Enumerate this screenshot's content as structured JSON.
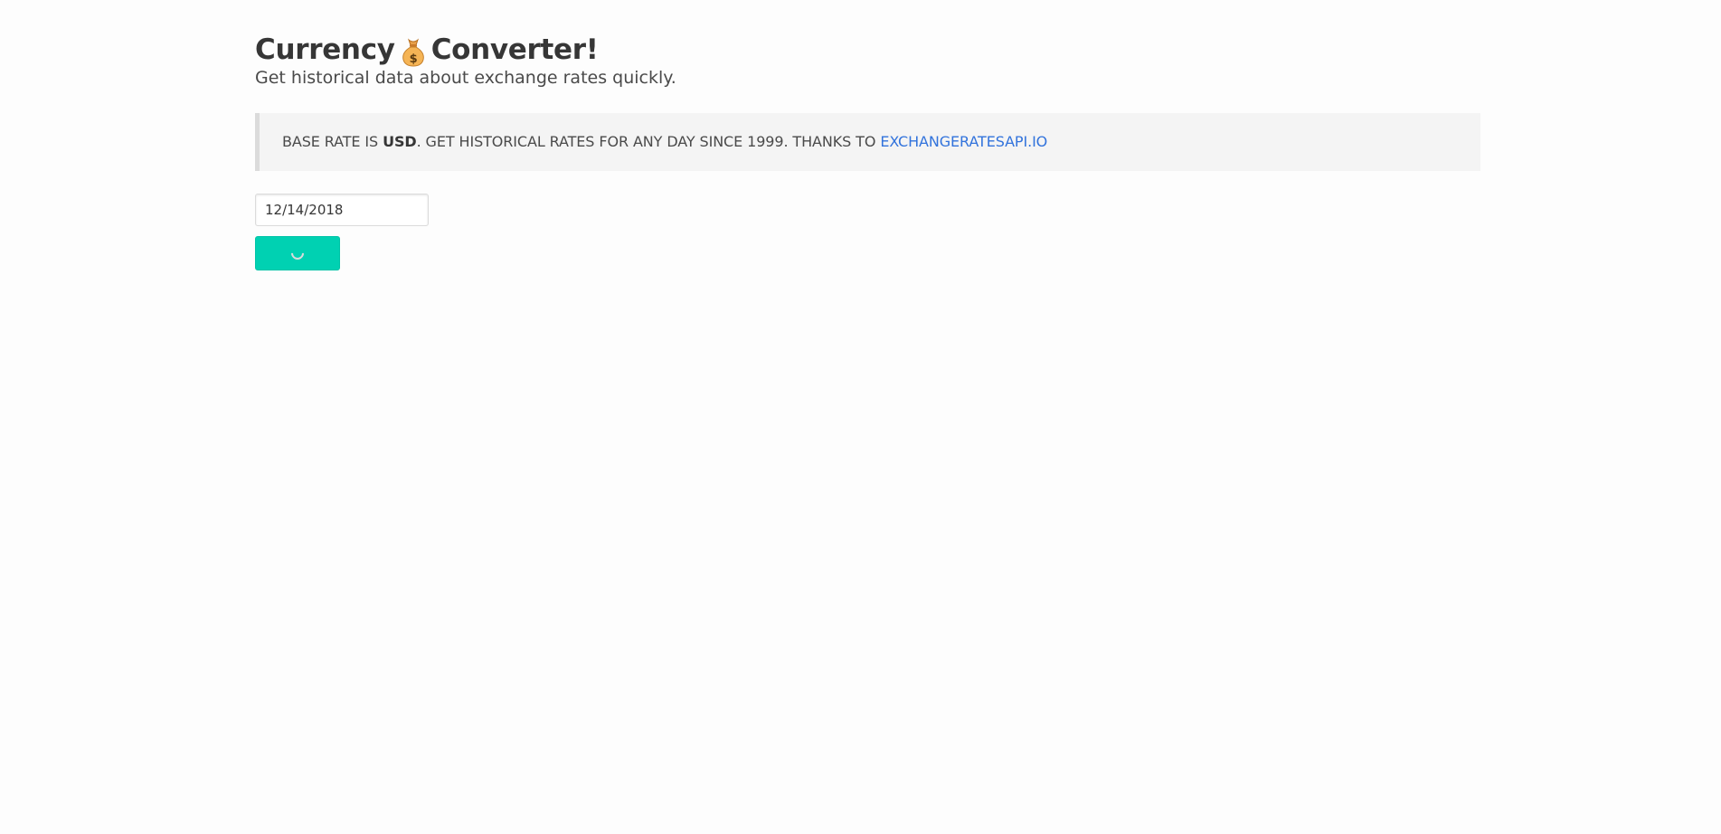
{
  "header": {
    "title_before": "Currency",
    "title_after": "Converter!",
    "icon": "money-bag-icon",
    "subtitle": "Get historical data about exchange rates quickly."
  },
  "notice": {
    "prefix": "BASE RATE IS ",
    "base": "USD",
    "middle": ". GET HISTORICAL RATES FOR ANY DAY SINCE 1999. THANKS TO ",
    "link_text": "EXCHANGERATESAPI.IO"
  },
  "form": {
    "date_value": "12/14/2018",
    "button_state": "loading"
  },
  "colors": {
    "accent": "#00d1b2",
    "link": "#3273dc",
    "notice_bg": "#f4f4f4"
  }
}
